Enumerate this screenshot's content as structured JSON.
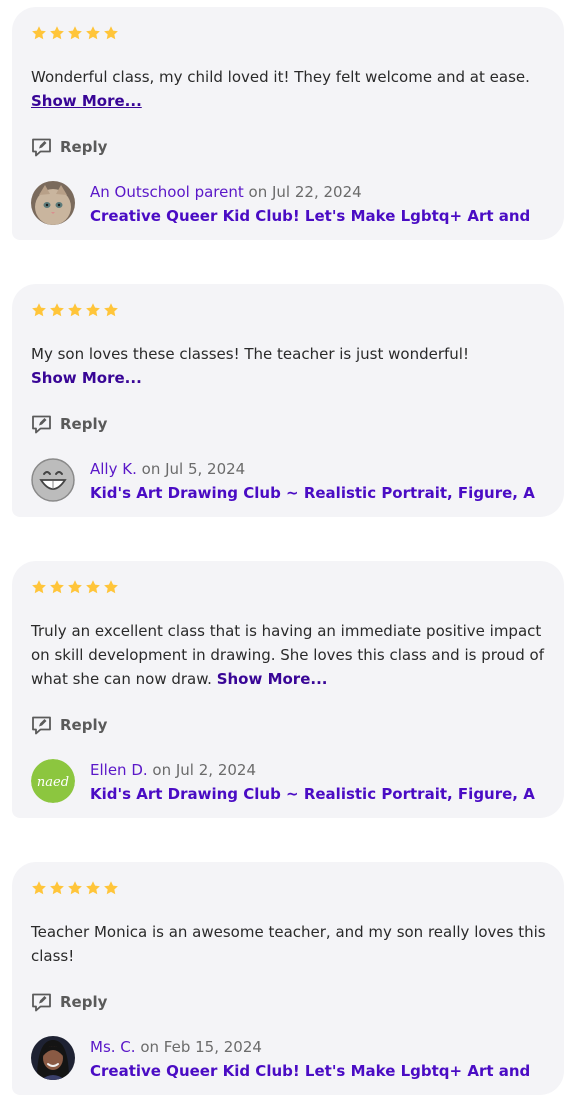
{
  "colors": {
    "card_background": "#f4f4f7",
    "star": "#ffc53a",
    "link": "#380596",
    "author": "#5a17c8",
    "class_link": "#4a0cc4",
    "muted": "#6b6b6b"
  },
  "reviews": [
    {
      "rating": 5,
      "text": "Wonderful class, my child loved it! They felt welcome and at ease.",
      "show_more": "Show More...",
      "reply_label": "Reply",
      "author": "An Outschool parent",
      "date": "on Jul 22, 2024",
      "class_title": "Creative Queer Kid Club! Let's Make Lgbtq+ Art and Chat",
      "avatar_icon": "cat-photo-avatar"
    },
    {
      "rating": 5,
      "text": "My son loves these classes! The teacher is just wonderful!",
      "show_more": "Show More...",
      "reply_label": "Reply",
      "author": "Ally K.",
      "date": "on Jul 5, 2024",
      "class_title": "Kid's Art Drawing Club ~ Realistic Portrait, Figure, Animal a",
      "avatar_icon": "smiley-face-avatar"
    },
    {
      "rating": 5,
      "text": "Truly an excellent class that is having an immediate positive impact on skill development in drawing. She loves this class and is proud of what she can now draw.",
      "show_more": "Show More...",
      "reply_label": "Reply",
      "author": "Ellen D.",
      "date": "on Jul 2, 2024",
      "class_title": "Kid's Art Drawing Club ~ Realistic Portrait, Figure, Animal a",
      "avatar_icon": "naed-logo-avatar",
      "avatar_text": "naed"
    },
    {
      "rating": 5,
      "text": "Teacher Monica is an awesome teacher, and my son really loves this class!",
      "reply_label": "Reply",
      "author": "Ms. C.",
      "date": "on Feb 15, 2024",
      "class_title": "Creative Queer Kid Club! Let's Make Lgbtq+ Art and Chat",
      "avatar_icon": "person-photo-avatar"
    }
  ]
}
